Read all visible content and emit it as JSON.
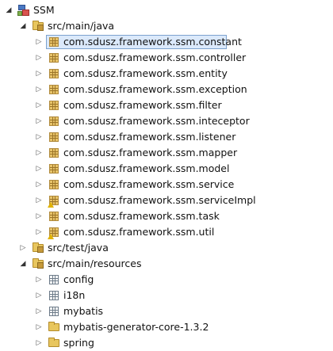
{
  "project": {
    "name": "SSM",
    "expanded": true
  },
  "sources": [
    {
      "name": "src/main/java",
      "expanded": true,
      "packages": [
        {
          "name": "com.sdusz.framework.ssm.constant",
          "selected": true,
          "warning": false
        },
        {
          "name": "com.sdusz.framework.ssm.controller",
          "selected": false,
          "warning": false
        },
        {
          "name": "com.sdusz.framework.ssm.entity",
          "selected": false,
          "warning": false
        },
        {
          "name": "com.sdusz.framework.ssm.exception",
          "selected": false,
          "warning": false
        },
        {
          "name": "com.sdusz.framework.ssm.filter",
          "selected": false,
          "warning": false
        },
        {
          "name": "com.sdusz.framework.ssm.inteceptor",
          "selected": false,
          "warning": false
        },
        {
          "name": "com.sdusz.framework.ssm.listener",
          "selected": false,
          "warning": false
        },
        {
          "name": "com.sdusz.framework.ssm.mapper",
          "selected": false,
          "warning": false
        },
        {
          "name": "com.sdusz.framework.ssm.model",
          "selected": false,
          "warning": false
        },
        {
          "name": "com.sdusz.framework.ssm.service",
          "selected": false,
          "warning": false
        },
        {
          "name": "com.sdusz.framework.ssm.serviceImpl",
          "selected": false,
          "warning": true
        },
        {
          "name": "com.sdusz.framework.ssm.task",
          "selected": false,
          "warning": false
        },
        {
          "name": "com.sdusz.framework.ssm.util",
          "selected": false,
          "warning": true
        }
      ]
    },
    {
      "name": "src/test/java",
      "expanded": false,
      "packages": []
    },
    {
      "name": "src/main/resources",
      "expanded": true,
      "children": [
        {
          "name": "config",
          "kind": "resource-folder"
        },
        {
          "name": "i18n",
          "kind": "resource-folder"
        },
        {
          "name": "mybatis",
          "kind": "resource-folder"
        },
        {
          "name": "mybatis-generator-core-1.3.2",
          "kind": "folder"
        },
        {
          "name": "spring",
          "kind": "folder"
        }
      ]
    }
  ],
  "icons": {
    "project": "project-icon",
    "source_folder": "source-folder-icon",
    "package": "package-icon",
    "folder": "folder-icon",
    "resource_folder": "resource-package-icon",
    "expand": "expand-arrow-icon",
    "collapse": "collapse-arrow-icon"
  }
}
